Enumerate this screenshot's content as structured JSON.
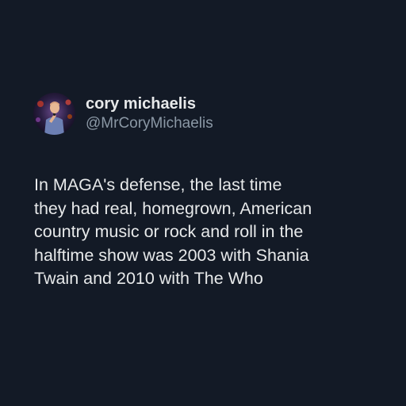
{
  "author": {
    "display_name": "cory michaelis",
    "handle": "@MrCoryMichaelis",
    "avatar_icon": "profile-photo-icon"
  },
  "tweet": {
    "lines": [
      "In MAGA's defense, the last time",
      "they had real, homegrown, American",
      "country music or rock and roll in the",
      "halftime show was 2003 with Shania",
      "Twain and 2010 with The Who"
    ]
  },
  "colors": {
    "background": "#131a26",
    "text_primary": "#e7e9ea",
    "text_secondary": "#8b98a5"
  }
}
